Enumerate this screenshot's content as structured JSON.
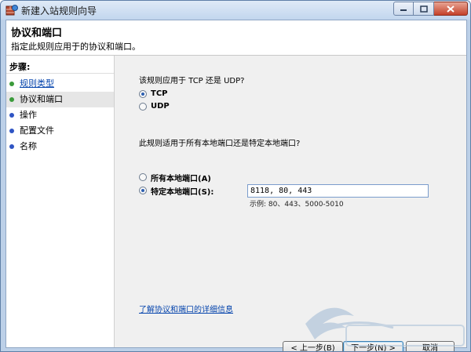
{
  "window": {
    "title": "新建入站规则向导",
    "close_icon": "close-icon",
    "maximize_icon": "maximize-icon",
    "minimize_icon": "minimize-icon"
  },
  "header": {
    "title": "协议和端口",
    "description": "指定此规则应用于的协议和端口。"
  },
  "steps": {
    "heading": "步骤:",
    "items": [
      {
        "label": "规则类型",
        "state": "completed",
        "dot_color": "#3b9b3b"
      },
      {
        "label": "协议和端口",
        "state": "current",
        "dot_color": "#3b9b3b"
      },
      {
        "label": "操作",
        "state": "pending",
        "dot_color": "#2f55c4"
      },
      {
        "label": "配置文件",
        "state": "pending",
        "dot_color": "#2f55c4"
      },
      {
        "label": "名称",
        "state": "pending",
        "dot_color": "#2f55c4"
      }
    ]
  },
  "protocol": {
    "question": "该规则应用于 TCP 还是 UDP?",
    "options": [
      {
        "label": "TCP",
        "selected": true
      },
      {
        "label": "UDP",
        "selected": false
      }
    ]
  },
  "ports": {
    "question": "此规则适用于所有本地端口还是特定本地端口?",
    "options": [
      {
        "label": "所有本地端口(A)",
        "selected": false
      },
      {
        "label": "特定本地端口(S):",
        "selected": true
      }
    ],
    "value": "8118, 80, 443",
    "example": "示例: 80、443、5000-5010"
  },
  "learn_more_link": "了解协议和端口的详细信息",
  "buttons": {
    "back": "< 上一步(B)",
    "next": "下一步(N) >",
    "cancel": "取消"
  },
  "colors": {
    "accent": "#2d5fb0",
    "link": "#0645ad",
    "completed_step": "#3b9b3b",
    "pending_step": "#2f55c4"
  }
}
